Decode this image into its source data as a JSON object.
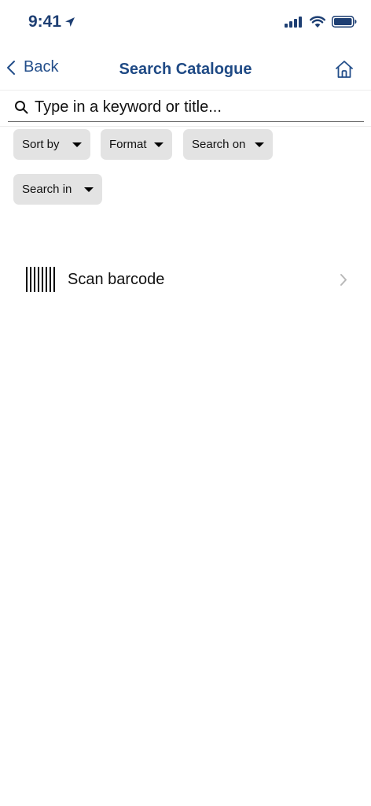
{
  "status_bar": {
    "time": "9:41",
    "location_icon": "location-arrow-icon",
    "signal_icon": "cellular-signal-icon",
    "wifi_icon": "wifi-icon",
    "battery_icon": "battery-icon"
  },
  "nav": {
    "back_label": "Back",
    "title": "Search Catalogue",
    "home_icon": "home-icon"
  },
  "search": {
    "placeholder": "Type in a keyword or title...",
    "value": ""
  },
  "filters": [
    {
      "label": "Sort by"
    },
    {
      "label": "Format"
    },
    {
      "label": "Search on"
    },
    {
      "label": "Search in"
    }
  ],
  "scan": {
    "label": "Scan barcode",
    "icon": "barcode-icon"
  },
  "colors": {
    "accent": "#234e8a",
    "chip_background": "#e3e3e3"
  }
}
